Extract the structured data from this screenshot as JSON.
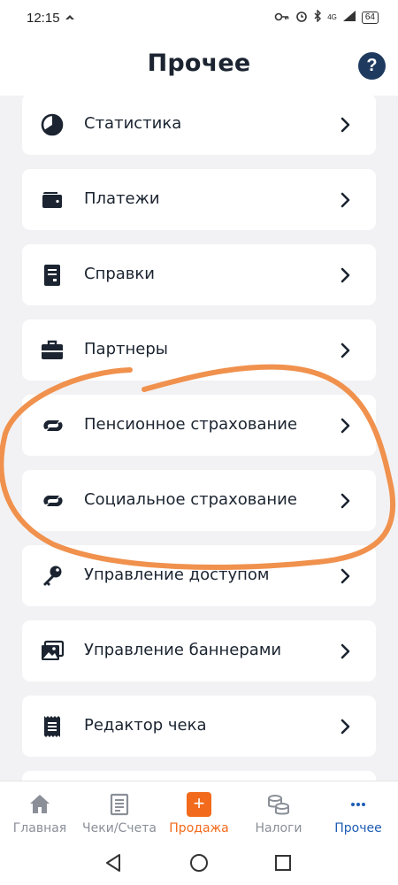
{
  "status_bar": {
    "time": "12:15",
    "network": "4G",
    "battery": "64"
  },
  "header": {
    "title": "Прочее",
    "help_label": "?"
  },
  "menu": {
    "items": [
      {
        "label": "Статистика",
        "icon": "pie-chart-icon"
      },
      {
        "label": "Платежи",
        "icon": "wallet-icon"
      },
      {
        "label": "Справки",
        "icon": "document-icon"
      },
      {
        "label": "Партнеры",
        "icon": "briefcase-icon"
      },
      {
        "label": "Пенсионное страхование",
        "icon": "sfr-logo-icon"
      },
      {
        "label": "Социальное страхование",
        "icon": "sfr-logo-icon"
      },
      {
        "label": "Управление доступом",
        "icon": "key-icon"
      },
      {
        "label": "Управление баннерами",
        "icon": "image-icon"
      },
      {
        "label": "Редактор чека",
        "icon": "receipt-icon"
      }
    ]
  },
  "bottom_nav": {
    "items": [
      {
        "label": "Главная",
        "icon": "home-icon"
      },
      {
        "label": "Чеки/Счета",
        "icon": "receipt-list-icon"
      },
      {
        "label": "Продажа",
        "icon": "plus-icon",
        "active_color": "#f26a1b"
      },
      {
        "label": "Налоги",
        "icon": "coins-icon"
      },
      {
        "label": "Прочее",
        "icon": "more-icon",
        "active_color": "#1e5cb3"
      }
    ]
  },
  "colors": {
    "accent_orange": "#f26a1b",
    "accent_blue": "#1e5cb3",
    "annotation_stroke": "#f0914d"
  }
}
